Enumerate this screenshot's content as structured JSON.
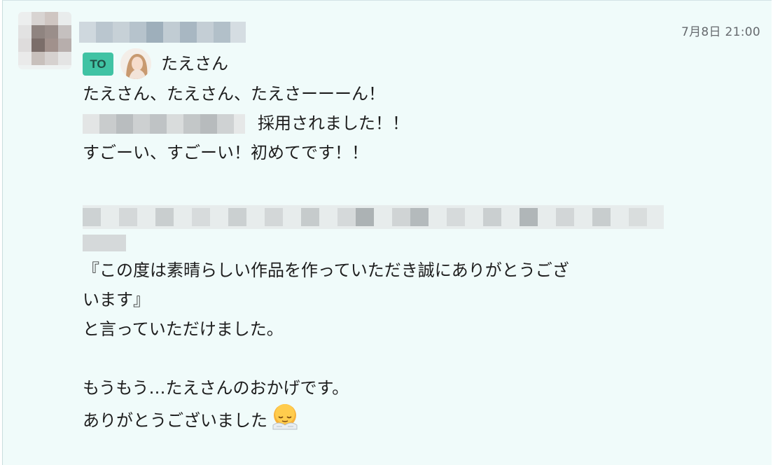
{
  "header": {
    "timestamp": "7月8日 21:00"
  },
  "to": {
    "badge": "TO",
    "name": "たえさん"
  },
  "message": {
    "line1": "たえさん、たえさん、たえさーーーん！",
    "line2": "採用されました！！",
    "line3": "すごーい、すごーい！初めてです！！",
    "line4": "『この度は素晴らしい作品を作っていただき誠にありがとうござ",
    "line5": "います』",
    "line6": "と言っていただけました。",
    "line7": "もうもう…たえさんのおかげです。",
    "line8": "ありがとうございました"
  },
  "icons": {
    "sender_avatar": "blurred-avatar",
    "recipient_avatar": "recipient-avatar",
    "emoji": "bowing-face-emoji"
  },
  "colors": {
    "message_background": "#f0fbfa",
    "to_badge": "#40c3a4",
    "text": "#1e1e1e",
    "timestamp": "#666a6e"
  }
}
